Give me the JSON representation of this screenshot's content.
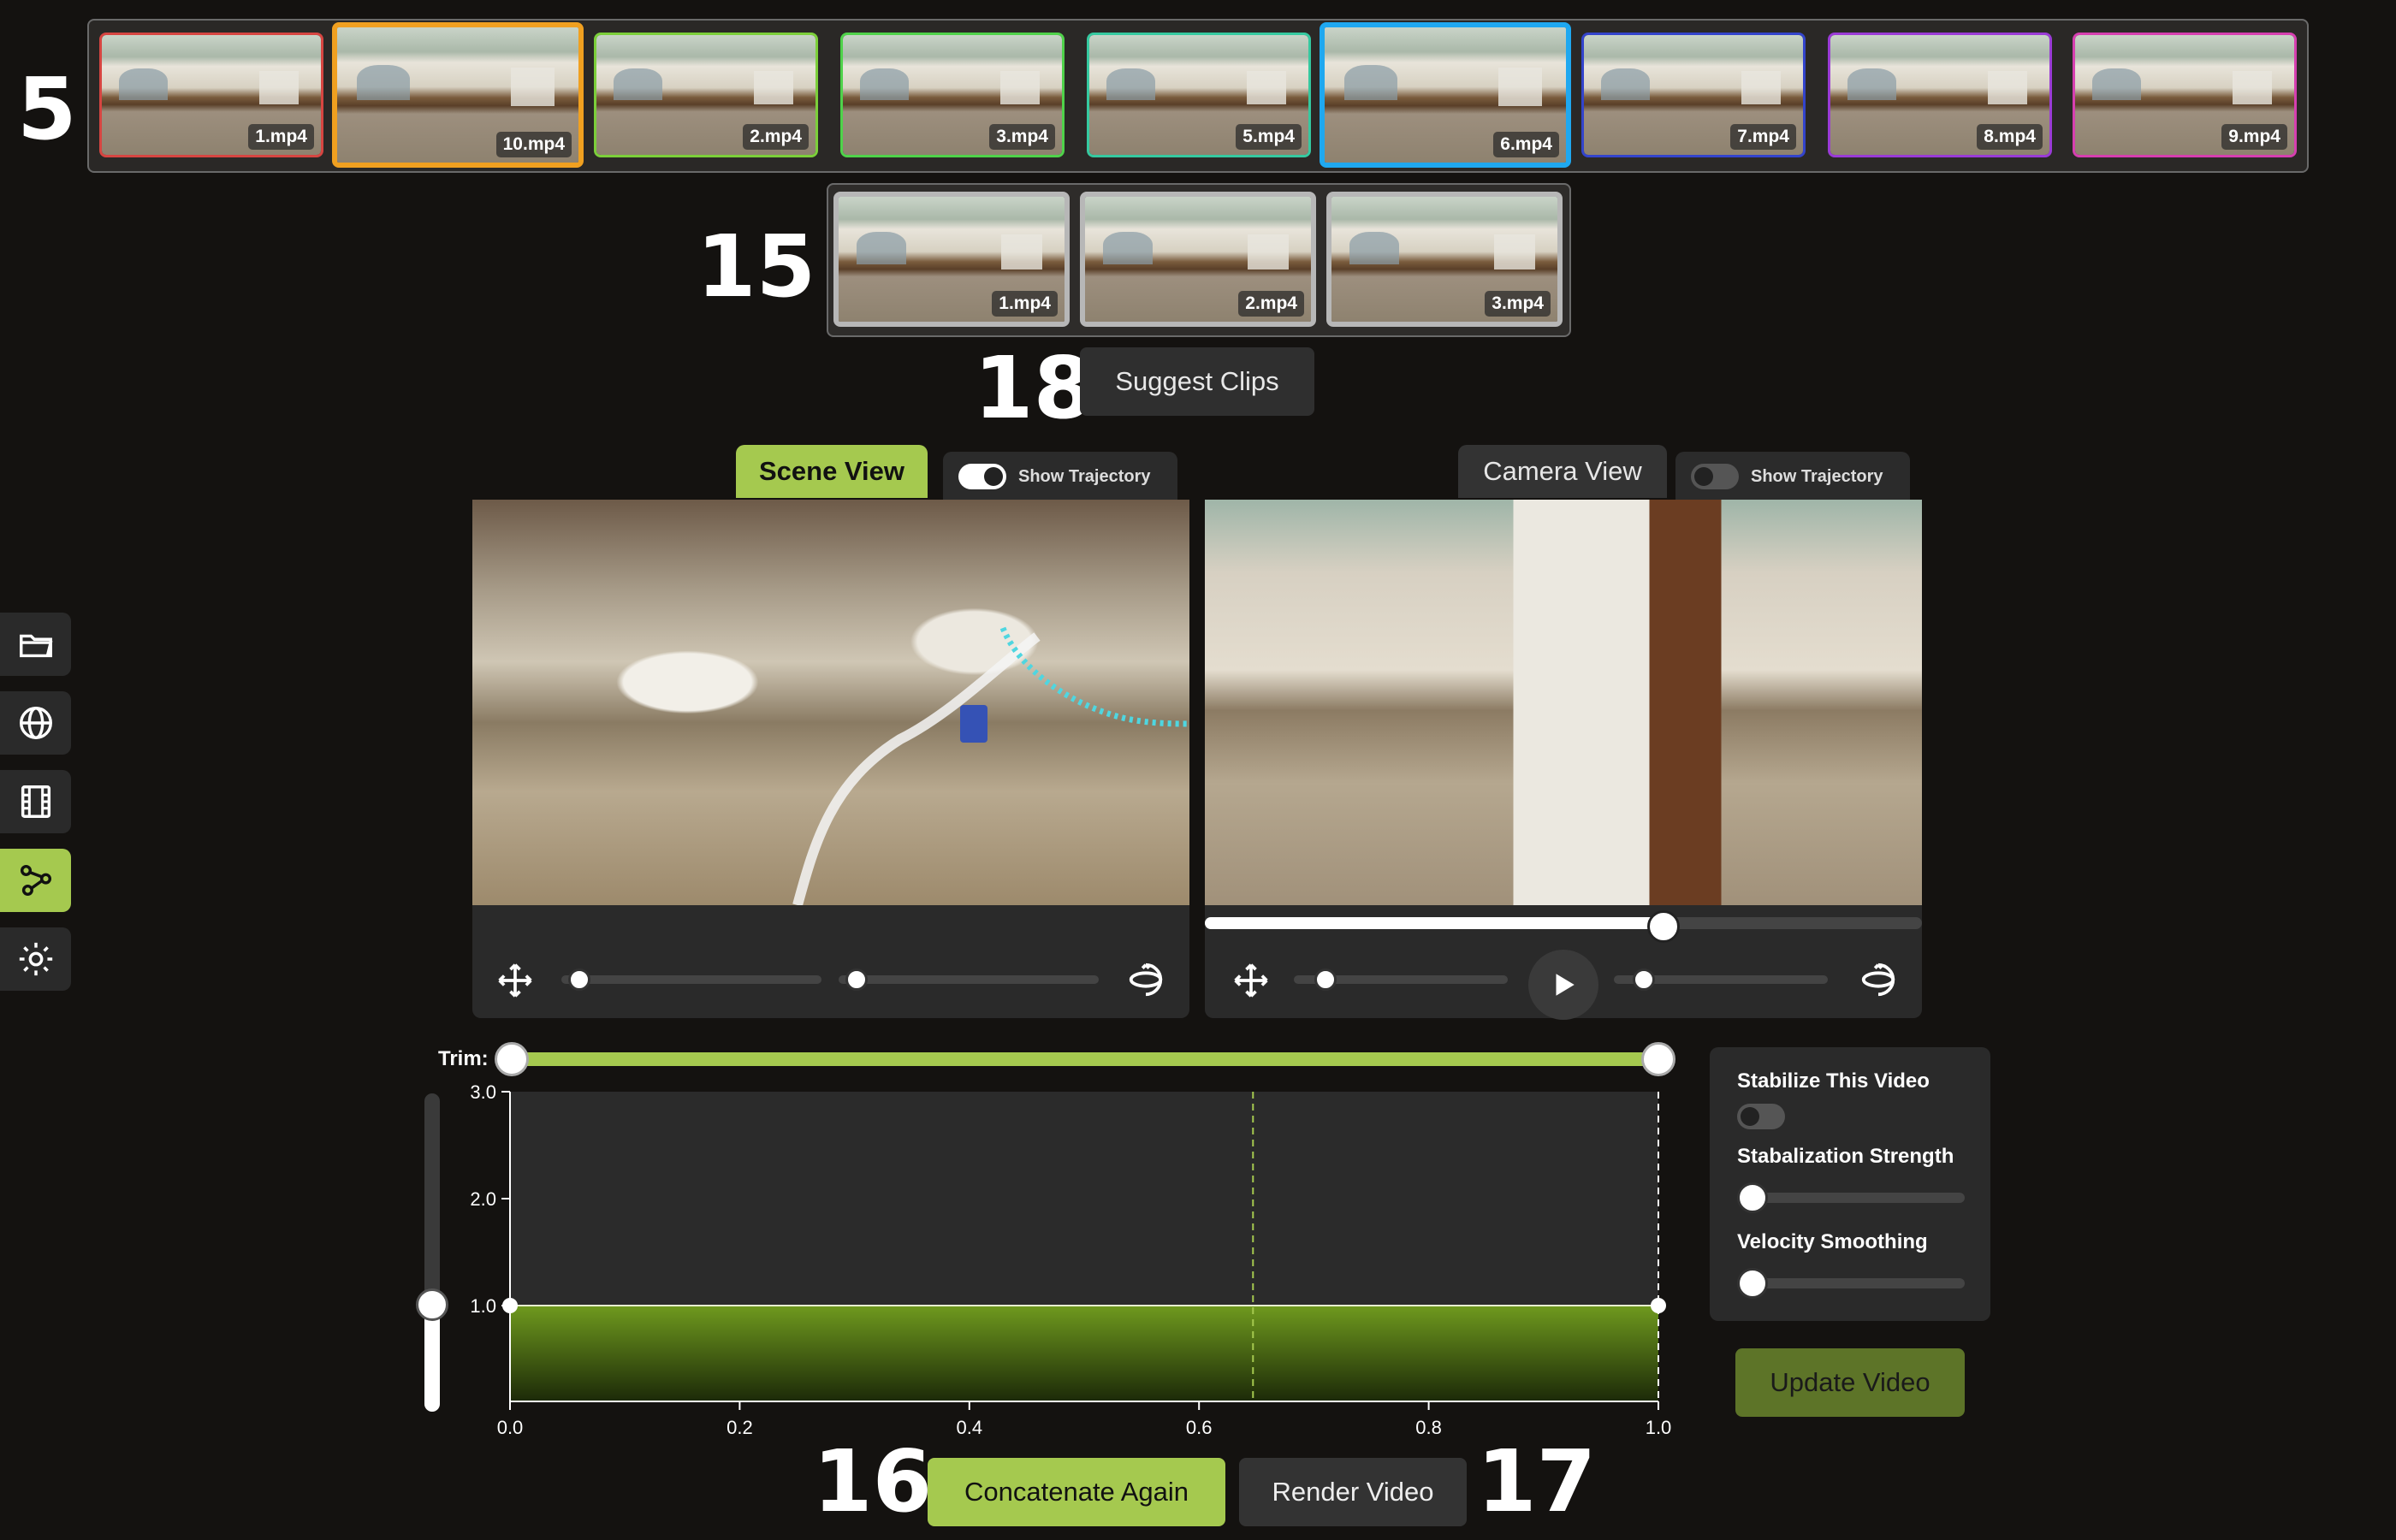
{
  "markers": {
    "strip": "5",
    "sub_strip": "15",
    "suggest": "18",
    "concat": "16",
    "render": "17"
  },
  "clips": [
    {
      "label": "1.mp4",
      "border": "#d64541"
    },
    {
      "label": "10.mp4",
      "border": "#f0a020",
      "selected": true
    },
    {
      "label": "2.mp4",
      "border": "#7ccf3a"
    },
    {
      "label": "3.mp4",
      "border": "#4fd24a"
    },
    {
      "label": "5.mp4",
      "border": "#35c9a0"
    },
    {
      "label": "6.mp4",
      "border": "#1fa8f0",
      "selected": true
    },
    {
      "label": "7.mp4",
      "border": "#3344cc"
    },
    {
      "label": "8.mp4",
      "border": "#9a3bd6"
    },
    {
      "label": "9.mp4",
      "border": "#d63fb0"
    }
  ],
  "sub_clips": [
    {
      "label": "1.mp4"
    },
    {
      "label": "2.mp4"
    },
    {
      "label": "3.mp4"
    }
  ],
  "suggest_button": "Suggest Clips",
  "sidebar": [
    {
      "icon": "folder-open-icon"
    },
    {
      "icon": "globe-icon"
    },
    {
      "icon": "film-icon"
    },
    {
      "icon": "trajectory-icon",
      "active": true
    },
    {
      "icon": "gear-icon"
    }
  ],
  "scene_view": {
    "tab": "Scene View",
    "toggle_label": "Show Trajectory",
    "toggle_on": true
  },
  "camera_view": {
    "tab": "Camera View",
    "toggle_label": "Show Trajectory",
    "toggle_on": false,
    "progress": 0.64
  },
  "timeline": {
    "trim_label": "Trim:",
    "trim_range": [
      0.0,
      1.0
    ],
    "y_ticks": [
      "3.0",
      "2.0",
      "1.0"
    ],
    "x_ticks": [
      "0.0",
      "0.2",
      "0.4",
      "0.6",
      "0.8",
      "1.0"
    ],
    "speed_value": 1.0,
    "playhead": 0.647
  },
  "settings": {
    "stabilize_label": "Stabilize This Video",
    "stabilize_on": false,
    "strength_label": "Stabalization Strength",
    "smoothing_label": "Velocity Smoothing",
    "update_button": "Update Video"
  },
  "buttons": {
    "concatenate": "Concatenate Again",
    "render": "Render Video"
  },
  "colors": {
    "accent": "#a5c94f",
    "background": "#141210",
    "panel": "#2a2a2a"
  }
}
